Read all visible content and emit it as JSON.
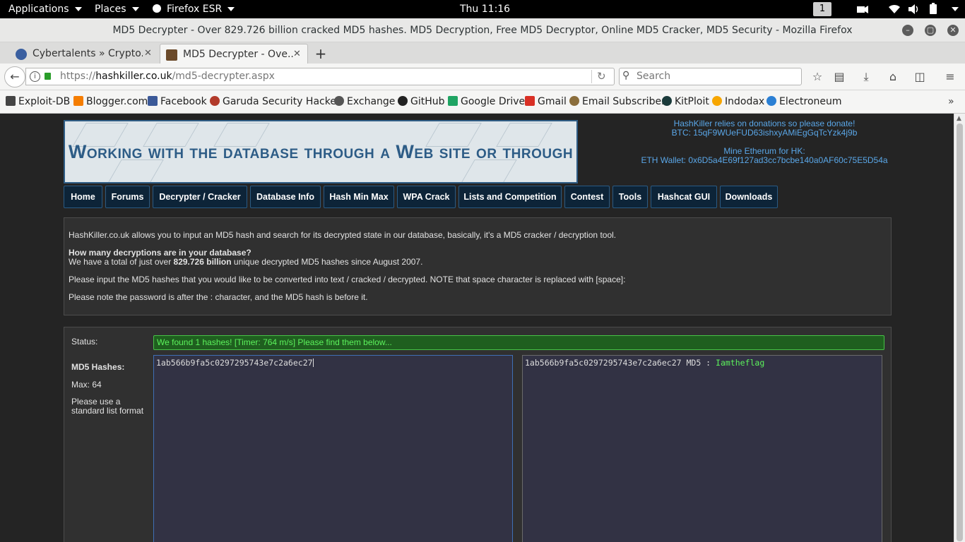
{
  "topbar": {
    "applications": "Applications",
    "places": "Places",
    "app": "Firefox ESR",
    "clock": "Thu 11:16",
    "workspace": "1"
  },
  "window": {
    "title": "MD5 Decrypter - Over 829.726 billion cracked MD5 hashes. MD5 Decryption, Free MD5 Decryptor, Online MD5 Cracker, MD5 Security - Mozilla Firefox"
  },
  "tabs": [
    {
      "label": "Cybertalents » Crypto...",
      "icon": "cybertalents-favicon",
      "active": false
    },
    {
      "label": "MD5 Decrypter - Ove...",
      "icon": "hashkiller-favicon",
      "active": true
    }
  ],
  "nav": {
    "url_prefix": "https://",
    "url_domain": "hashkiller.co.uk",
    "url_path": "/md5-decrypter.aspx",
    "search_placeholder": "Search"
  },
  "bookmarks": [
    {
      "label": "Exploit-DB",
      "icon": "exploitdb-icon",
      "color": "#444444"
    },
    {
      "label": "Blogger.com",
      "icon": "blogger-icon",
      "color": "#f57d00"
    },
    {
      "label": "Facebook",
      "icon": "facebook-icon",
      "color": "#3b5998"
    },
    {
      "label": "Garuda Security Hacker",
      "icon": "garuda-icon",
      "color": "#b23a2a"
    },
    {
      "label": "Exchange",
      "icon": "exchange-icon",
      "color": "#555555"
    },
    {
      "label": "GitHub",
      "icon": "github-icon",
      "color": "#222222"
    },
    {
      "label": "Google Drive",
      "icon": "google-drive-icon",
      "color": "#1fa463"
    },
    {
      "label": "Gmail",
      "icon": "gmail-icon",
      "color": "#d93025"
    },
    {
      "label": "Email Subscriber",
      "icon": "email-subscriber-icon",
      "color": "#8a6d3b"
    },
    {
      "label": "KitPloit",
      "icon": "kitploit-icon",
      "color": "#1a3a3a"
    },
    {
      "label": "Indodax",
      "icon": "indodax-icon",
      "color": "#f7a600"
    },
    {
      "label": "Electroneum",
      "icon": "electroneum-icon",
      "color": "#2a7fd4"
    }
  ],
  "page": {
    "banner_text": "Working with the database through a Web site or through a program Clent!",
    "donate": {
      "line1": "HashKiller relies on donations so please donate!",
      "btc": "BTC: 15qF9WUeFUD63ishxyAMiEgGqTcYzk4j9b",
      "eth_title": "Mine Etherum for HK:",
      "eth": "ETH Wallet: 0x6D5a4E69f127ad3cc7bcbe140a0AF60c75E5D54a"
    },
    "menu": [
      "Home",
      "Forums",
      "Decrypter / Cracker",
      "Database Info",
      "Hash Min Max",
      "WPA Crack",
      "Lists and Competition",
      "Contest",
      "Tools",
      "Hashcat GUI",
      "Downloads"
    ],
    "info": {
      "intro": "HashKiller.co.uk allows you to input an MD5 hash and search for its decrypted state in our database, basically, it's a MD5 cracker / decryption tool.",
      "question": "How many decryptions are in your database?",
      "answer_pre": "We have a total of just over ",
      "answer_bold": "829.726 billion",
      "answer_post": " unique decrypted MD5 hashes since August 2007.",
      "instructions": "Please input the MD5 hashes that you would like to be converted into text / cracked / decrypted. NOTE that space character is replaced with [space]:",
      "note": "Please note the password is after the : character, and the MD5 hash is before it."
    },
    "form": {
      "status_label": "Status:",
      "status_text": "We found 1 hashes! [Timer: 764 m/s] Please find them below...",
      "hashes_label": "MD5 Hashes:",
      "max_label": "Max: 64",
      "format_label": "Please use a standard list format",
      "input_value": "1ab566b9fa5c0297295743e7c2a6ec27",
      "output_hash": "1ab566b9fa5c0297295743e7c2a6ec27 MD5 : ",
      "output_password": "Iamtheflag"
    }
  }
}
